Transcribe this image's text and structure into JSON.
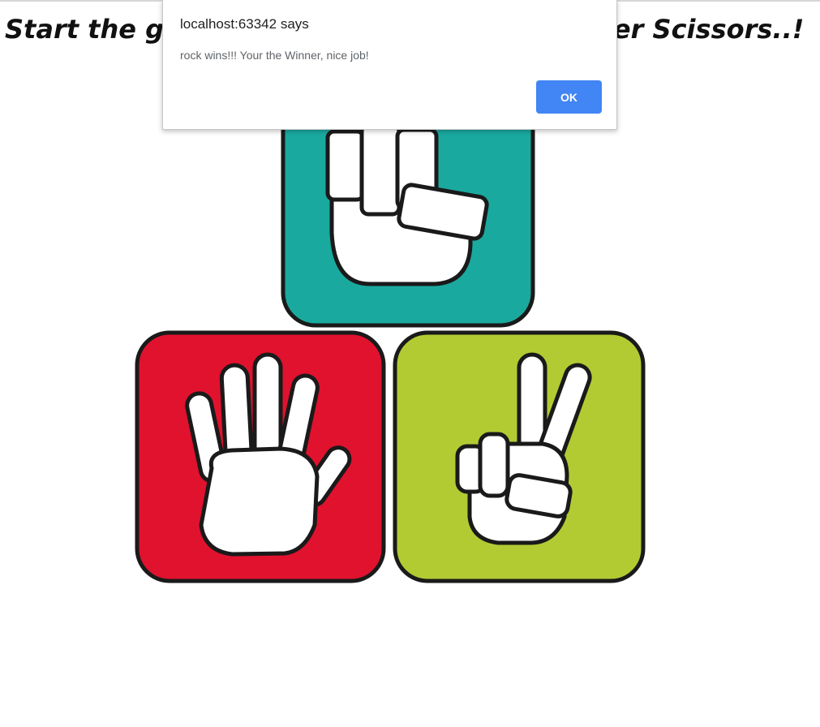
{
  "page": {
    "heading_left": "Start the gar",
    "heading_right": "per Scissors..!"
  },
  "dialog": {
    "title": "localhost:63342 says",
    "message": "rock wins!!! Your the Winner, nice job!",
    "ok_label": "OK"
  },
  "choices": [
    {
      "id": "rock",
      "color": "#1aa99f"
    },
    {
      "id": "paper",
      "color": "#e0122e"
    },
    {
      "id": "scissors",
      "color": "#b3cb33"
    }
  ]
}
